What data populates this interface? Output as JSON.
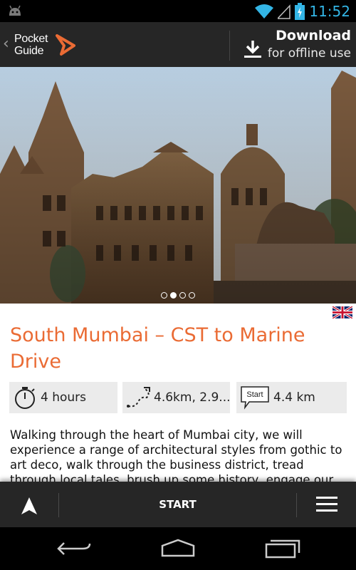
{
  "status_bar": {
    "time": "11:52",
    "icons": [
      "android-icon",
      "wifi-icon",
      "signal-icon",
      "battery-charging-icon"
    ]
  },
  "header": {
    "logo": {
      "line1": "Pocket",
      "line2": "Guide",
      "arrow_color": "#ea6b34"
    },
    "download": {
      "title": "Download",
      "subtitle": "for offline use"
    }
  },
  "hero": {
    "pager_count": 4,
    "pager_active": 1
  },
  "content": {
    "language_flag": "uk-flag-icon",
    "title": "South Mumbai – CST to Marine Drive",
    "stats": {
      "duration": "4 hours",
      "distance": "4.6km, 2.9...",
      "start_badge": "Start",
      "start_distance": "4.4 km"
    },
    "description": "Walking through the heart of Mumbai city, we will experience a range of architectural styles from gothic to art deco, walk through the business district, tread through local tales, brush up some history, engage our senses"
  },
  "action_bar": {
    "start_label": "START"
  },
  "colors": {
    "accent": "#ea6b34",
    "header_bg": "#262626",
    "stat_bg": "#ebebeb",
    "clock": "#33b5e5"
  }
}
